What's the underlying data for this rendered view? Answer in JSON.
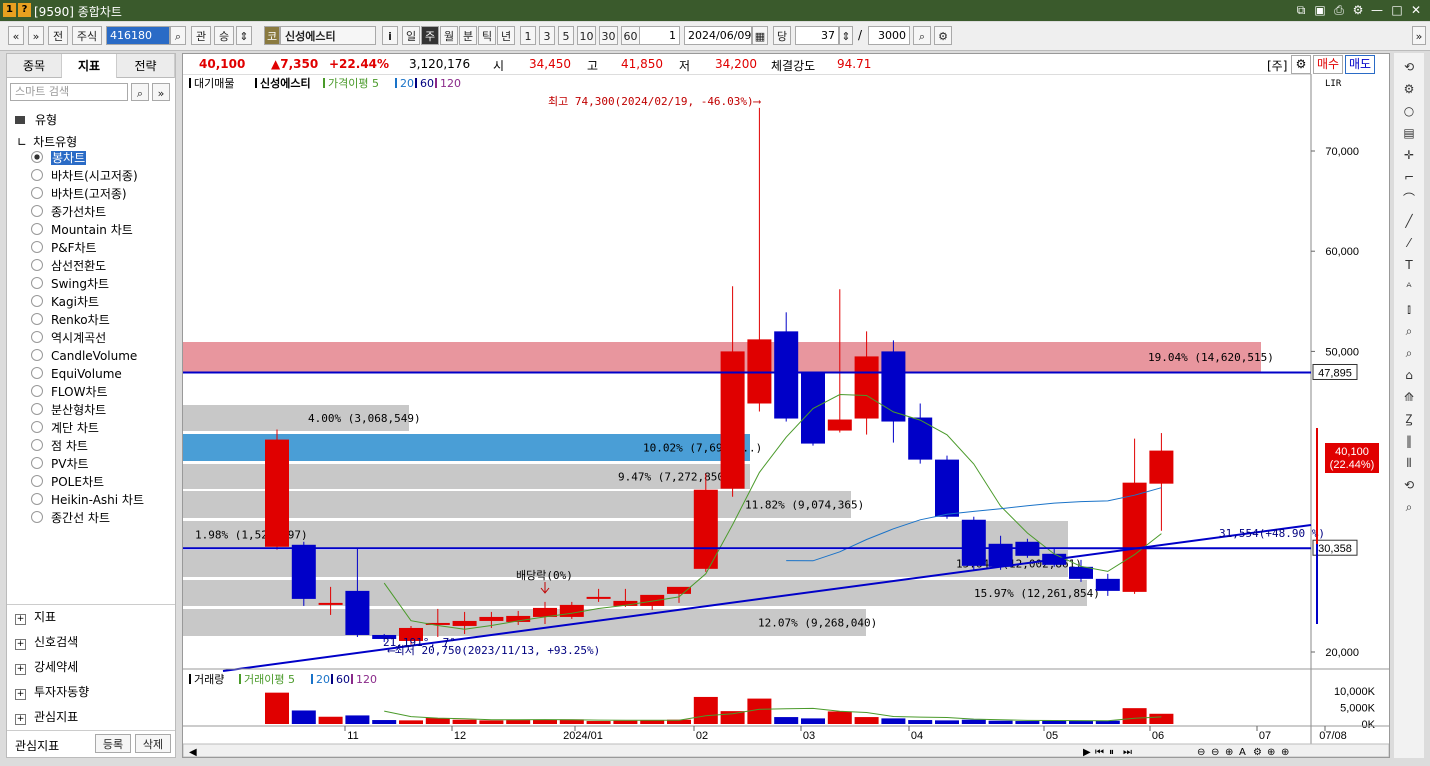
{
  "window": {
    "title": "[9590] 종합차트",
    "badge1": "1",
    "badge2": "?"
  },
  "toolbar": {
    "nav_prev": "«",
    "nav_down": "»",
    "btn_prev": "전",
    "market": "주식",
    "code": "416180",
    "btn_gwan": "관",
    "btn_seung": "승",
    "stock_prefix": "코",
    "stock_name": "신성에스티",
    "info_btn": "i",
    "periods": [
      "일",
      "주",
      "월",
      "분",
      "틱",
      "년"
    ],
    "active_period": "주",
    "intervals": [
      "1",
      "3",
      "5",
      "10",
      "30",
      "60"
    ],
    "interval_value": "1",
    "date": "2024/06/09",
    "dang_label": "당",
    "count": "37",
    "slash": "/",
    "max_count": "3000"
  },
  "left_panel": {
    "tabs": [
      "종목",
      "지표",
      "전략"
    ],
    "active_tab": "지표",
    "search_placeholder": "스마트 검색",
    "section_title": "유형",
    "tree_label": "차트유형",
    "chart_types": [
      "봉차트",
      "바차트(시고저종)",
      "바차트(고저종)",
      "종가선차트",
      "Mountain 차트",
      "P&F차트",
      "삼선전환도",
      "Swing차트",
      "Kagi차트",
      "Renko차트",
      "역시계곡선",
      "CandleVolume",
      "EquiVolume",
      "FLOW차트",
      "분산형차트",
      "계단 차트",
      "점 차트",
      "PV차트",
      "POLE차트",
      "Heikin-Ashi 차트",
      "종간선 차트"
    ],
    "selected_type": "봉차트",
    "accordion": [
      "지표",
      "신호검색",
      "강세약세",
      "투자자동향",
      "관심지표"
    ],
    "footer_label": "관심지표",
    "btn_register": "등록",
    "btn_delete": "삭제"
  },
  "infobar": {
    "price": "40,100",
    "change": "▲7,350",
    "change_pct": "+22.44%",
    "volume": "3,120,176",
    "open_label": "시",
    "open": "34,450",
    "high_label": "고",
    "high": "41,850",
    "low_label": "저",
    "low": "34,200",
    "strength_label": "체결강도",
    "strength": "94.71",
    "unit": "[주]",
    "buy": "매수",
    "sell": "매도"
  },
  "legend": {
    "l1": "대기매물",
    "l2": "신성에스티",
    "l3": "가격이평 5",
    "l4": "20",
    "l5": "60",
    "l6": "120",
    "v1": "거래량",
    "v2": "거래이평 5",
    "v3": "20",
    "v4": "60",
    "v5": "120"
  },
  "colors": {
    "up": "#e00000",
    "down": "#0000c8",
    "ma5": "#4a9a2a",
    "ma20": "#1a73c8",
    "ma60": "#000080",
    "ma120": "#8a2a8a",
    "band": "#c8c8c8",
    "band_hl": "#4a9ed6",
    "band_top": "#e8969e"
  },
  "annotations": {
    "high_note": "최고 74,300(2024/02/19, -46.03%)⟶",
    "low_note": "⟵최저 20,750(2023/11/13, +93.25%)",
    "dividend": "배당락(0%)",
    "trend_angle": "21.191°, 7°",
    "trend_value": "31,554(+48.90 %)",
    "line_price": "47,895",
    "line_price2": "30,358",
    "cur_price": "40,100",
    "cur_pct": "(22.44%)"
  },
  "chart_data": {
    "type": "candlestick",
    "x_ticks": [
      "11",
      "12",
      "2024/01",
      "02",
      "03",
      "04",
      "05",
      "06",
      "07",
      "07/08"
    ],
    "y_ticks": [
      "70,000",
      "60,000",
      "50,000",
      "20,000"
    ],
    "volume_ticks": [
      "10,000K",
      "5,000K",
      "0K"
    ],
    "candles": [
      {
        "o": 30500,
        "h": 42200,
        "l": 30200,
        "c": 41200
      },
      {
        "o": 30700,
        "h": 31000,
        "l": 24600,
        "c": 25300
      },
      {
        "o": 24900,
        "h": 26500,
        "l": 23700,
        "c": 24900
      },
      {
        "o": 26100,
        "h": 30300,
        "l": 21500,
        "c": 21700
      },
      {
        "o": 21700,
        "h": 21800,
        "l": 21000,
        "c": 21300
      },
      {
        "o": 21100,
        "h": 22600,
        "l": 20750,
        "c": 22400
      },
      {
        "o": 22700,
        "h": 24300,
        "l": 21500,
        "c": 22900
      },
      {
        "o": 22600,
        "h": 24000,
        "l": 21800,
        "c": 23100
      },
      {
        "o": 23100,
        "h": 24000,
        "l": 22400,
        "c": 23500
      },
      {
        "o": 23000,
        "h": 24100,
        "l": 22700,
        "c": 23600
      },
      {
        "o": 23500,
        "h": 25000,
        "l": 22800,
        "c": 24400
      },
      {
        "o": 23500,
        "h": 25000,
        "l": 23300,
        "c": 24700
      },
      {
        "o": 25300,
        "h": 26300,
        "l": 25000,
        "c": 25500
      },
      {
        "o": 24600,
        "h": 26300,
        "l": 24500,
        "c": 25100
      },
      {
        "o": 24600,
        "h": 25400,
        "l": 24200,
        "c": 25700
      },
      {
        "o": 25800,
        "h": 26300,
        "l": 24900,
        "c": 26500
      },
      {
        "o": 28300,
        "h": 37800,
        "l": 28000,
        "c": 36200
      },
      {
        "o": 36300,
        "h": 56500,
        "l": 35500,
        "c": 50000
      },
      {
        "o": 44800,
        "h": 74300,
        "l": 44000,
        "c": 51200
      },
      {
        "o": 52000,
        "h": 53900,
        "l": 43000,
        "c": 43300
      },
      {
        "o": 47800,
        "h": 48000,
        "l": 40600,
        "c": 40800
      },
      {
        "o": 42100,
        "h": 56200,
        "l": 41900,
        "c": 43200
      },
      {
        "o": 43300,
        "h": 52000,
        "l": 41700,
        "c": 49500
      },
      {
        "o": 50000,
        "h": 51100,
        "l": 40900,
        "c": 43000
      },
      {
        "o": 43400,
        "h": 44800,
        "l": 38800,
        "c": 39200
      },
      {
        "o": 39200,
        "h": 39600,
        "l": 33300,
        "c": 33500
      },
      {
        "o": 33200,
        "h": 33500,
        "l": 28100,
        "c": 28600
      },
      {
        "o": 30800,
        "h": 31600,
        "l": 28200,
        "c": 28500
      },
      {
        "o": 31000,
        "h": 31300,
        "l": 29400,
        "c": 29600
      },
      {
        "o": 29800,
        "h": 30300,
        "l": 28500,
        "c": 28700
      },
      {
        "o": 28500,
        "h": 29200,
        "l": 27000,
        "c": 27300
      },
      {
        "o": 27300,
        "h": 27800,
        "l": 25600,
        "c": 26100
      },
      {
        "o": 26000,
        "h": 41300,
        "l": 25800,
        "c": 36900
      },
      {
        "o": 36800,
        "h": 41850,
        "l": 32100,
        "c": 40100
      }
    ],
    "volumes": [
      9500,
      4100,
      2200,
      2600,
      1200,
      1100,
      1800,
      1300,
      1100,
      1200,
      1300,
      1400,
      900,
      1000,
      1100,
      1300,
      8200,
      3900,
      7700,
      2100,
      1700,
      3800,
      2100,
      1700,
      1200,
      1100,
      1300,
      1000,
      900,
      1000,
      900,
      1000,
      4800,
      3100
    ]
  },
  "volume_bands": [
    {
      "label": "4.00% (3,068,549)"
    },
    {
      "label": "10.02% (7,692,...)"
    },
    {
      "label": "9.47% (7,272,850)"
    },
    {
      "label": "11.82% (9,074,365)"
    },
    {
      "label": "1.98% (1,523,897)"
    },
    {
      "label": "15.64% (12,002,861)"
    },
    {
      "label": "15.97% (12,261,854)"
    },
    {
      "label": "12.07% (9,268,040)"
    },
    {
      "label": "19.04% (14,620,515)"
    }
  ]
}
